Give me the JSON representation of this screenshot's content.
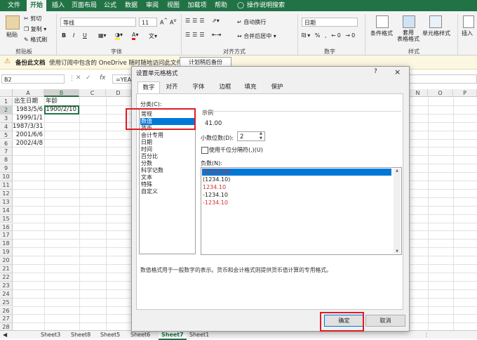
{
  "menu": [
    "文件",
    "开始",
    "插入",
    "页面布局",
    "公式",
    "数据",
    "审阅",
    "视图",
    "加载项",
    "帮助"
  ],
  "menu_tell": "操作说明搜索",
  "ribbon": {
    "paste": "粘贴",
    "cut": "剪切",
    "copy": "复制",
    "format_painter": "格式刷",
    "font_name": "等线",
    "font_size": "11",
    "bold": "B",
    "italic": "I",
    "underline": "U",
    "wrap_text": "自动换行",
    "merge_center": "合并后居中",
    "number_format": "日期",
    "cond_format": "条件格式",
    "table_format": "套用\n表格格式",
    "cell_styles": "单元格样式",
    "insert": "插入",
    "groups": [
      "剪贴板",
      "字体",
      "对齐方式",
      "数字",
      "样式"
    ]
  },
  "warning": {
    "title": "备份此文档",
    "message": "使用订阅中包含的 OneDrive 随时随地访问此文件。",
    "button": "计划稍后备份"
  },
  "formula_bar": {
    "name_box": "B2",
    "fx": "fx",
    "formula": "=YEAR"
  },
  "columns": [
    "A",
    "B",
    "C",
    "D",
    "N",
    "O",
    "P"
  ],
  "rows": [
    "1",
    "2",
    "3",
    "4",
    "5",
    "6",
    "7",
    "8",
    "9",
    "10",
    "11",
    "12",
    "13",
    "14",
    "15",
    "16",
    "17",
    "18",
    "19",
    "20",
    "21",
    "22",
    "23",
    "24",
    "25",
    "26",
    "27",
    "28"
  ],
  "cells": {
    "A1": "出生日期",
    "B1": "年龄",
    "A2": "1983/5/6",
    "B2": "1900/2/10",
    "A3": "1999/1/1",
    "A4": "1987/3/31",
    "A5": "2001/6/6",
    "A6": "2002/4/8"
  },
  "dialog": {
    "title": "设置单元格格式",
    "help": "?",
    "close": "×",
    "tabs": [
      "数字",
      "对齐",
      "字体",
      "边框",
      "填充",
      "保护"
    ],
    "category_label": "分类(C):",
    "categories": [
      "常规",
      "数值",
      "货币",
      "会计专用",
      "日期",
      "时间",
      "百分比",
      "分数",
      "科学记数",
      "文本",
      "特殊",
      "自定义"
    ],
    "selected_category": "数值",
    "sample_label": "示例",
    "sample_value": "41.00",
    "decimal_label": "小数位数(D):",
    "decimal_value": "2",
    "thousands_label": "使用千位分隔符(,)(U)",
    "negative_label": "负数(N):",
    "negatives": [
      {
        "text": "(1234.10)",
        "color": "#d32f2f"
      },
      {
        "text": "(1234.10)",
        "color": "#222222"
      },
      {
        "text": "1234.10",
        "color": "#d32f2f"
      },
      {
        "text": "-1234.10",
        "color": "#222222"
      },
      {
        "text": "-1234.10",
        "color": "#d32f2f"
      }
    ],
    "description": "数值格式用于一般数字的表示。货币和会计格式则提供货币值计算的专用格式。",
    "ok": "确定",
    "cancel": "取消"
  },
  "sheets": [
    "Sheet3",
    "Sheet8",
    "Sheet5",
    "Sheet6",
    "Sheet7",
    "Sheet1"
  ],
  "active_sheet": "Sheet7",
  "colors": {
    "excel_green": "#217346",
    "selection_blue": "#0078d7",
    "highlight_red": "#e01b24"
  }
}
